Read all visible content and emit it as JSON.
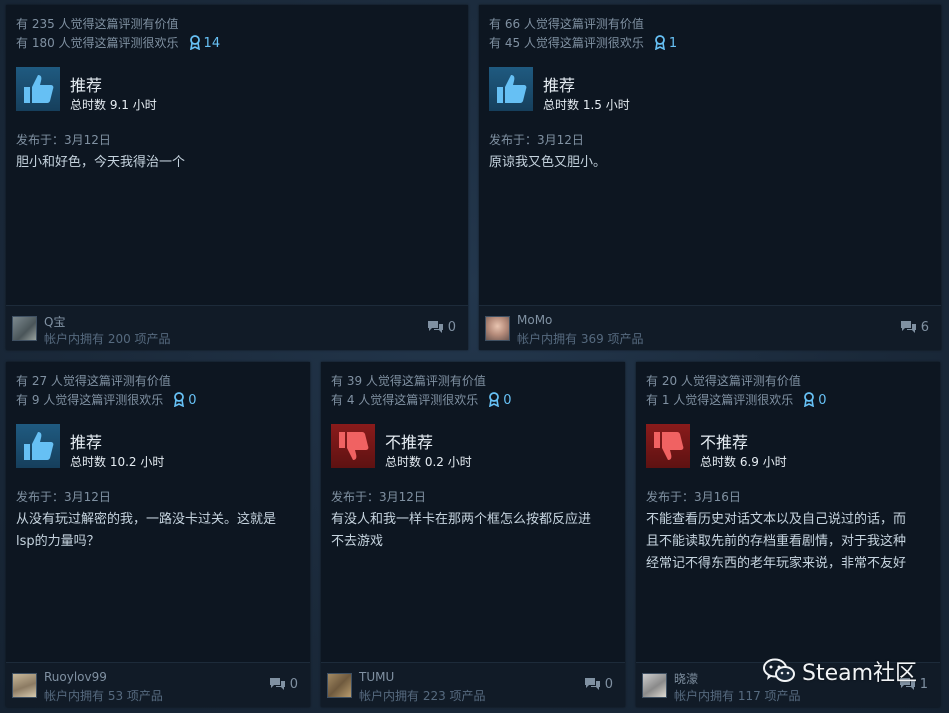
{
  "reviews": [
    {
      "helpful": "有 235 人觉得这篇评测有价值",
      "funny": "有 180 人觉得这篇评测很欢乐",
      "awards": "14",
      "verdict": "推荐",
      "verdict_type": "recommended",
      "hours": "总时数 9.1 小时",
      "posted": "发布于：3月12日",
      "content": "胆小和好色，今天我得治一个",
      "username": "Q宝",
      "products": "帐户内拥有 200 项产品",
      "comments": "0"
    },
    {
      "helpful": "有 66 人觉得这篇评测有价值",
      "funny": "有 45 人觉得这篇评测很欢乐",
      "awards": "1",
      "verdict": "推荐",
      "verdict_type": "recommended",
      "hours": "总时数 1.5 小时",
      "posted": "发布于：3月12日",
      "content": "原谅我又色又胆小。",
      "username": "MoMo",
      "products": "帐户内拥有 369 项产品",
      "comments": "6"
    },
    {
      "helpful": "有 27 人觉得这篇评测有价值",
      "funny": "有 9 人觉得这篇评测很欢乐",
      "awards": "0",
      "verdict": "推荐",
      "verdict_type": "recommended",
      "hours": "总时数 10.2 小时",
      "posted": "发布于：3月12日",
      "content_lines": [
        "从没有玩过解密的我，一路没卡过关。这就是",
        "lsp的力量吗？"
      ],
      "username": "Ruoylov99",
      "products": "帐户内拥有 53 项产品",
      "comments": "0"
    },
    {
      "helpful": "有 39 人觉得这篇评测有价值",
      "funny": "有 4 人觉得这篇评测很欢乐",
      "awards": "0",
      "verdict": "不推荐",
      "verdict_type": "not_recommended",
      "hours": "总时数 0.2 小时",
      "posted": "发布于：3月12日",
      "content_lines": [
        "有没人和我一样卡在那两个框怎么按都反应进",
        "不去游戏"
      ],
      "username": "TUMU",
      "products": "帐户内拥有 223 项产品",
      "comments": "0"
    },
    {
      "helpful": "有 20 人觉得这篇评测有价值",
      "funny": "有 1 人觉得这篇评测很欢乐",
      "awards": "0",
      "verdict": "不推荐",
      "verdict_type": "not_recommended",
      "hours": "总时数 6.9 小时",
      "posted": "发布于：3月16日",
      "content_lines": [
        "不能查看历史对话文本以及自己说过的话，而",
        "且不能读取先前的存档重看剧情，对于我这种",
        "经常记不得东西的老年玩家来说，非常不友好"
      ],
      "username": "晓濛",
      "products": "帐户内拥有 117 项产品",
      "comments": "1"
    }
  ],
  "watermark": "Steam社区",
  "colors": {
    "accent": "#67c1f5",
    "recommended": "#1f5a80",
    "not_recommended": "#8a1b1b"
  }
}
